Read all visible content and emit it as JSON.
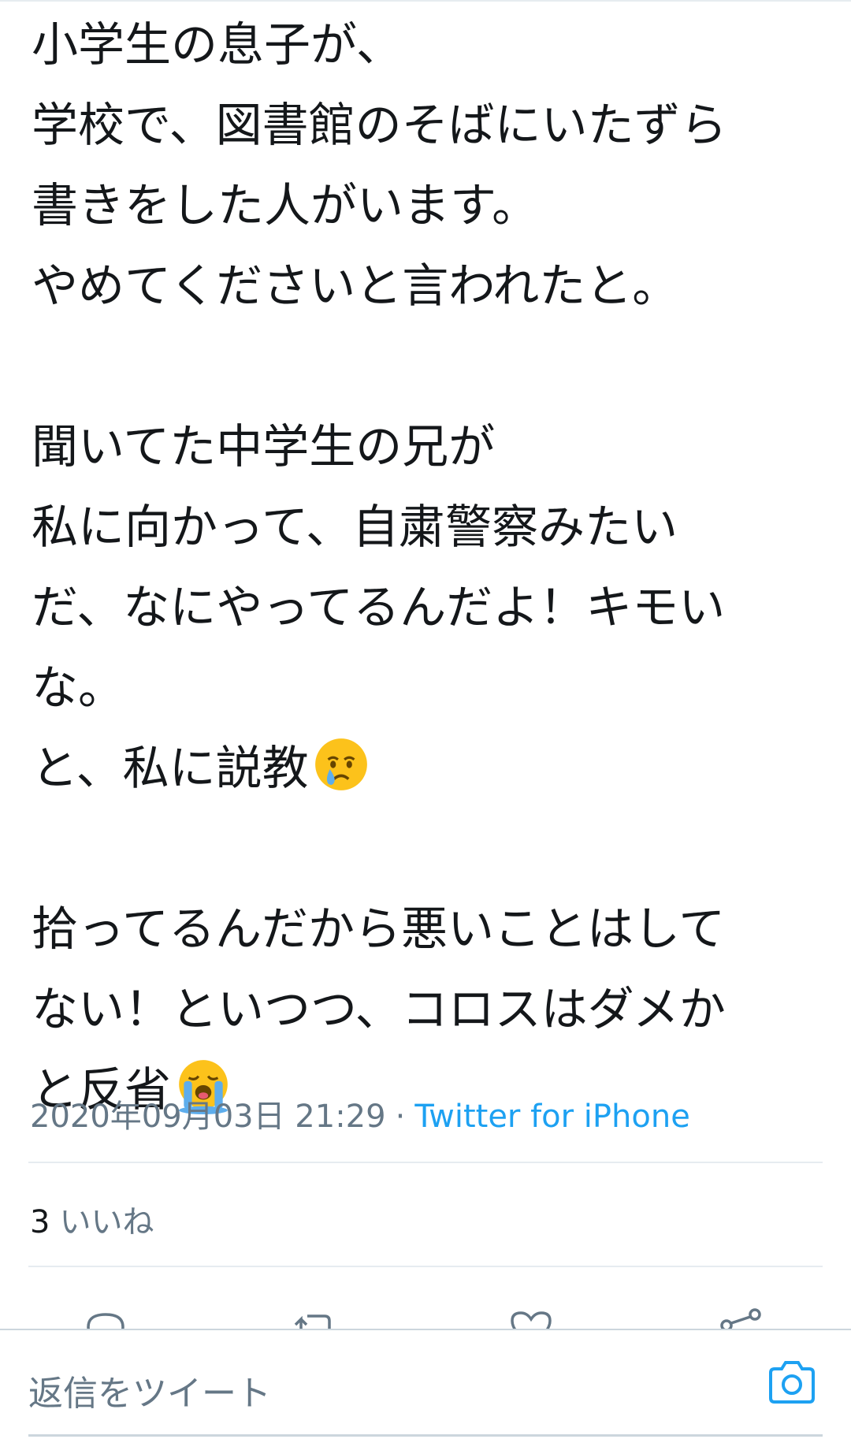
{
  "tweet": {
    "lines": [
      "小学生の息子が、",
      "学校で、図書館のそばにいたずら",
      "書きをした人がいます。",
      "やめてくださいと言われたと。",
      "",
      "聞いてた中学生の兄が",
      "私に向かって、自粛警察みたい",
      "だ、なにやってるんだよ！キモい",
      "な。",
      "と、私に説教",
      "",
      "拾ってるんだから悪いことはして",
      "ない！といつつ、コロスはダメか",
      "と反省"
    ],
    "emojis": {
      "line10": "crying-face-emoji",
      "line14": "loudly-crying-face-emoji"
    },
    "timestamp": "2020年09月03日 21:29",
    "separator": "·",
    "source": "Twitter for iPhone"
  },
  "engagement": {
    "likes_count": "3",
    "likes_label": "いいね"
  },
  "actions": {
    "icons": [
      "reply-icon",
      "retweet-icon",
      "like-icon",
      "share-icon"
    ]
  },
  "reply_bar": {
    "placeholder": "返信をツイート",
    "camera_icon": "camera-icon"
  },
  "colors": {
    "text": "#14171a",
    "secondary": "#657786",
    "accent": "#1da1f2",
    "divider": "#e6ecf0"
  }
}
